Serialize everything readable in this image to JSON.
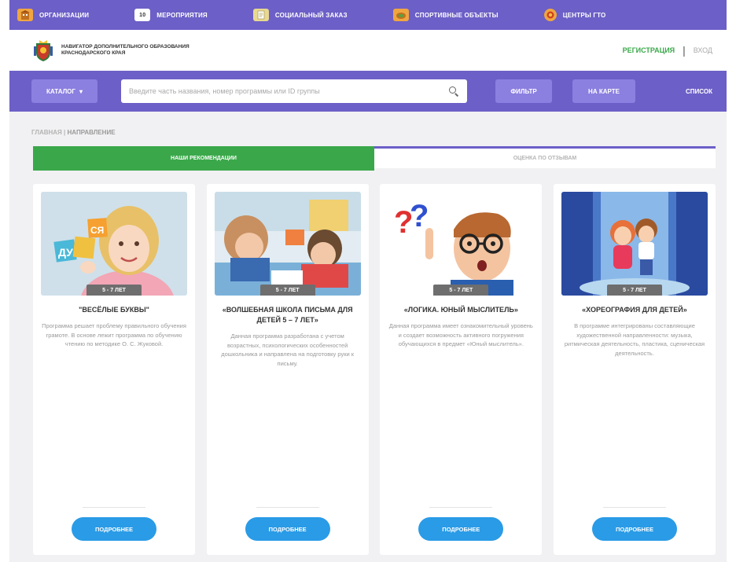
{
  "topnav": {
    "items": [
      {
        "label": "ОРГАНИЗАЦИИ",
        "icon": "building-icon",
        "color": "#f0a640"
      },
      {
        "label": "МЕРОПРИЯТИЯ",
        "icon": "calendar-icon",
        "color": "#ffffff",
        "badge": "10"
      },
      {
        "label": "СОЦИАЛЬНЫЙ ЗАКАЗ",
        "icon": "document-icon",
        "color": "#e8d890"
      },
      {
        "label": "СПОРТИВНЫЕ ОБЪЕКТЫ",
        "icon": "stadium-icon",
        "color": "#f0a640"
      },
      {
        "label": "ЦЕНТРЫ ГТО",
        "icon": "medal-icon",
        "color": "#f0a640"
      }
    ]
  },
  "header": {
    "brand_text": "НАВИГАТОР ДОПОЛНИТЕЛЬНОГО ОБРАЗОВАНИЯ КРАСНОДАРСКОГО КРАЯ",
    "register": "РЕГИСТРАЦИЯ",
    "separator": "|",
    "login": "ВХОД"
  },
  "searchbar": {
    "catalog_label": "КАТАЛОГ",
    "catalog_arrow": "▾",
    "search_placeholder": "Введите часть названия, номер программы или ID группы",
    "filter_label": "ФИЛЬТР",
    "map_label": "НА КАРТЕ",
    "list_label": "СПИСОК"
  },
  "breadcrumb": {
    "home": "ГЛАВНАЯ",
    "separator": "|",
    "current": "НАПРАВЛЕНИЕ"
  },
  "tabs": {
    "recommendations": "НАШИ РЕКОМЕНДАЦИИ",
    "reviews": "ОЦЕНКА ПО ОТЗЫВАМ"
  },
  "cards": [
    {
      "age": "5 - 7 ЛЕТ",
      "title": "\"ВЕСЁЛЫЕ БУКВЫ\"",
      "desc": "Программа решает проблему правильного обучения грамоте. В основе лежит программа по обучению чтению по методике О. С. Жуковой.",
      "button": "ПОДРОБНЕЕ"
    },
    {
      "age": "5 - 7 ЛЕТ",
      "title": "«ВОЛШЕБНАЯ ШКОЛА ПИСЬМА ДЛЯ ДЕТЕЙ 5 – 7 ЛЕТ»",
      "desc": "Данная программа разработана с учетом возрастных, психологических особенностей дошкольника и направлена на подготовку руки к письму.",
      "button": "ПОДРОБНЕЕ"
    },
    {
      "age": "5 - 7 ЛЕТ",
      "title": "«ЛОГИКА. ЮНЫЙ МЫСЛИТЕЛЬ»",
      "desc": "Данная программа имеет ознакомительный уровень и создает возможность активного погружения обучающихся в предмет «Юный мыслитель».",
      "button": "ПОДРОБНЕЕ"
    },
    {
      "age": "5 - 7 ЛЕТ",
      "title": "«ХОРЕОГРАФИЯ ДЛЯ ДЕТЕЙ»",
      "desc": "В программе интегрированы составляющие художественной направленности: музыка, ритмическая деятельность, пластика, сценическая деятельность.",
      "button": "ПОДРОБНЕЕ"
    }
  ],
  "colors": {
    "brand_purple": "#6c5fc7",
    "button_purple": "#8b7fe0",
    "green": "#3aa84a",
    "blue_button": "#2a9be6"
  }
}
